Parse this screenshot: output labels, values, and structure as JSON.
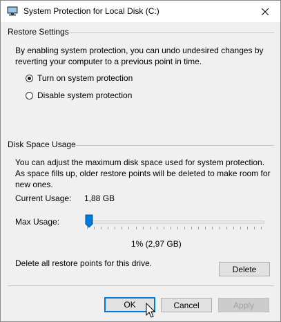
{
  "window": {
    "title": "System Protection for Local Disk (C:)",
    "close_label": "✕"
  },
  "restore_settings": {
    "heading": "Restore Settings",
    "description": "By enabling system protection, you can undo undesired changes by reverting your computer to a previous point in time.",
    "options": [
      {
        "label": "Turn on system protection",
        "selected": true
      },
      {
        "label": "Disable system protection",
        "selected": false
      }
    ]
  },
  "disk_space": {
    "heading": "Disk Space Usage",
    "description": "You can adjust the maximum disk space used for system protection. As space fills up, older restore points will be deleted to make room for new ones.",
    "current_usage_label": "Current Usage:",
    "current_usage_value": "1,88 GB",
    "max_usage_label": "Max Usage:",
    "max_usage_value": "1% (2,97 GB)",
    "max_usage_fraction": 0.01,
    "delete_text": "Delete all restore points for this drive.",
    "delete_button": "Delete"
  },
  "footer": {
    "ok": "OK",
    "cancel": "Cancel",
    "apply": "Apply"
  },
  "colors": {
    "accent": "#0078d7",
    "background": "#f0f0f0"
  }
}
